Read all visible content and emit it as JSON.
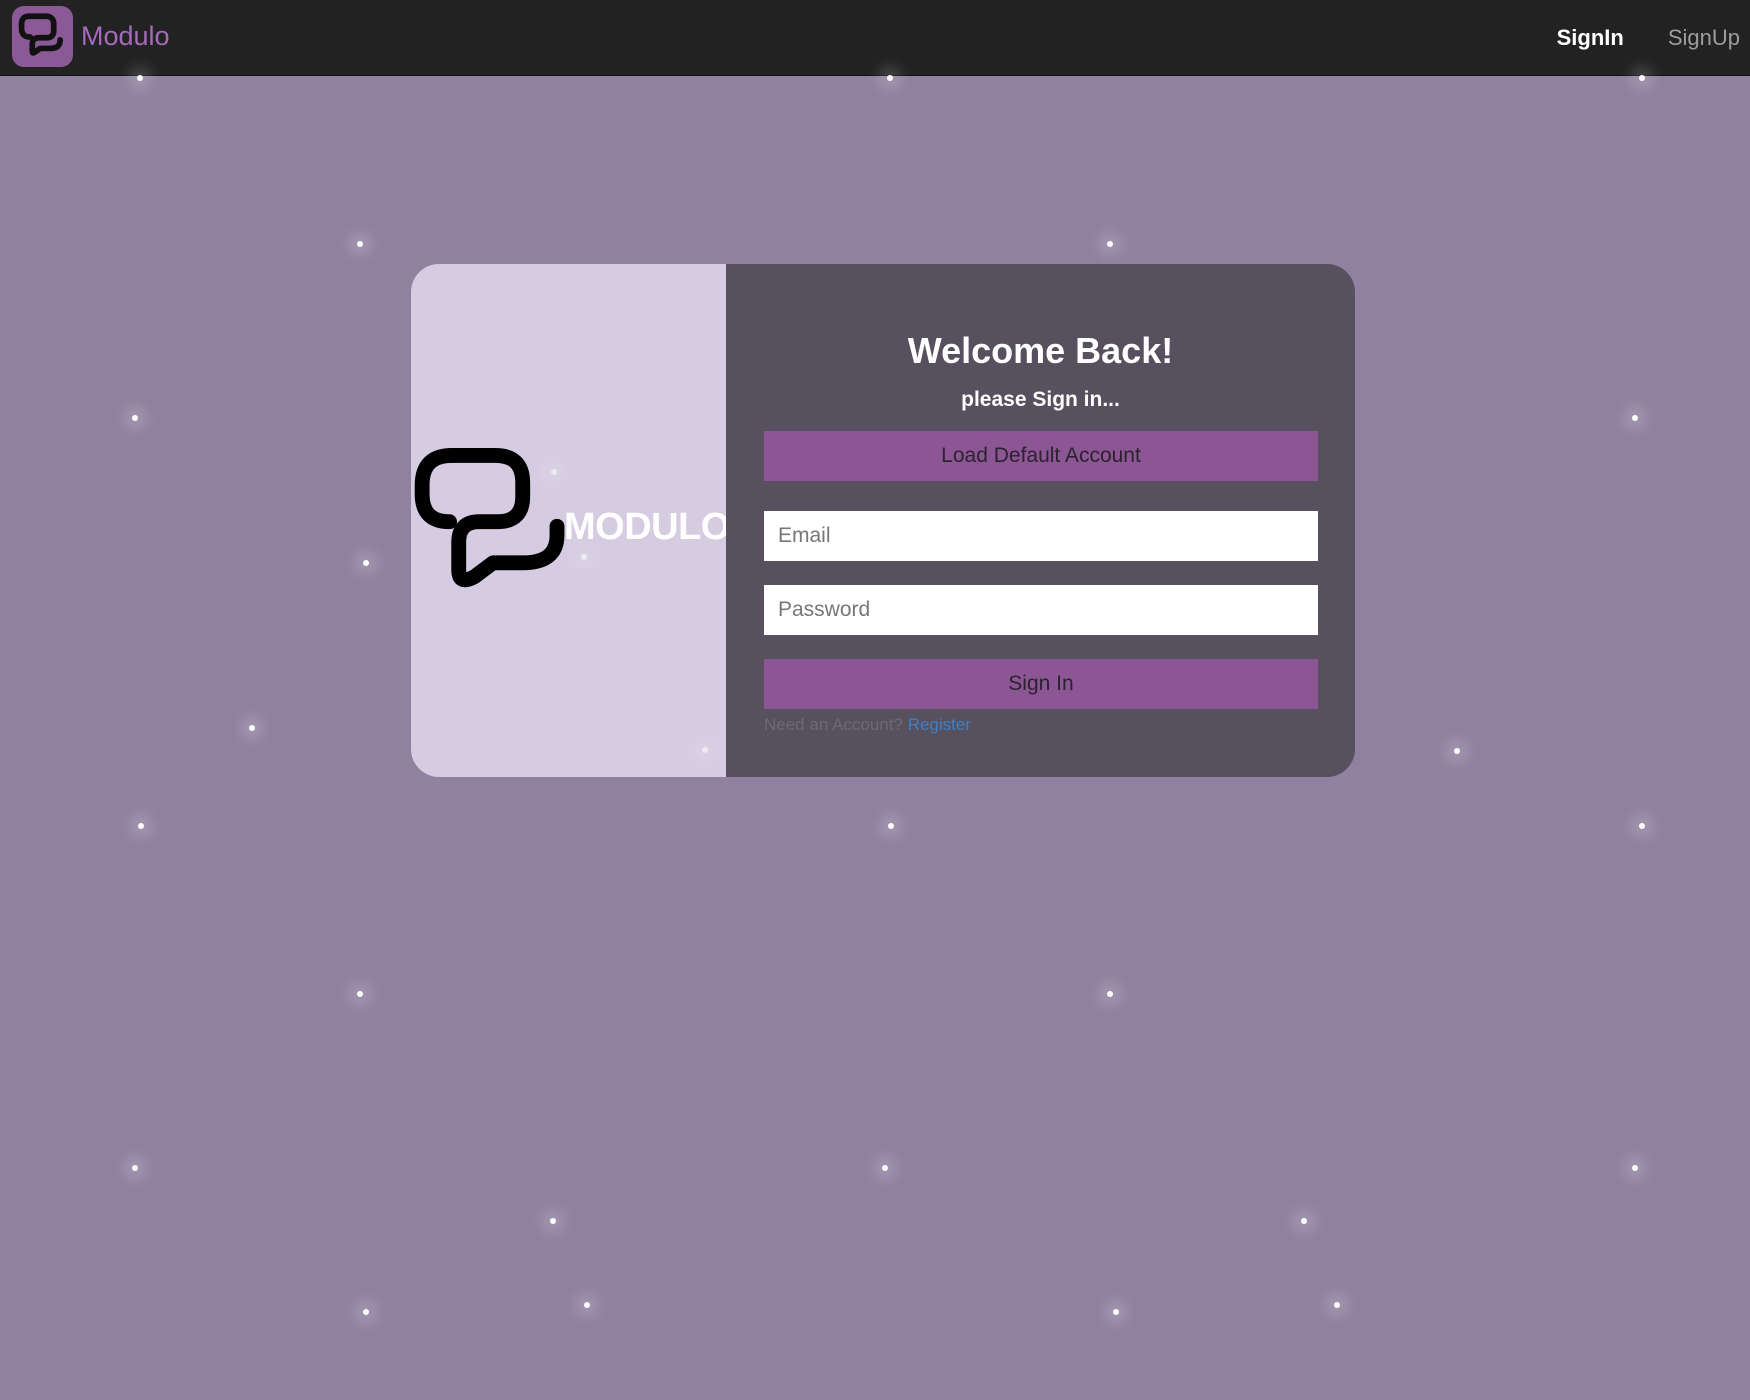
{
  "navbar": {
    "brand_name": "Modulo",
    "links": [
      {
        "label": "SignIn",
        "active": true
      },
      {
        "label": "SignUp",
        "active": false
      }
    ]
  },
  "card": {
    "logo_text": "MODULO",
    "title": "Welcome Back!",
    "subtitle": "please Sign in...",
    "load_default_label": "Load Default Account",
    "email_placeholder": "Email",
    "password_placeholder": "Password",
    "signin_label": "Sign In",
    "need_account_text": "Need an Account?",
    "register_link": "Register"
  },
  "colors": {
    "page_background": "#9181a0",
    "navbar_background": "#222222",
    "brand_accent": "#8b5a96",
    "card_left_background": "#d6cce2",
    "card_right_background": "#57505e",
    "button_background": "#8c5694",
    "link_color": "#3f7fc4"
  },
  "icons": {
    "brand_logo": "modulo-speech-bubbles-icon",
    "card_logo": "modulo-speech-bubbles-icon"
  }
}
